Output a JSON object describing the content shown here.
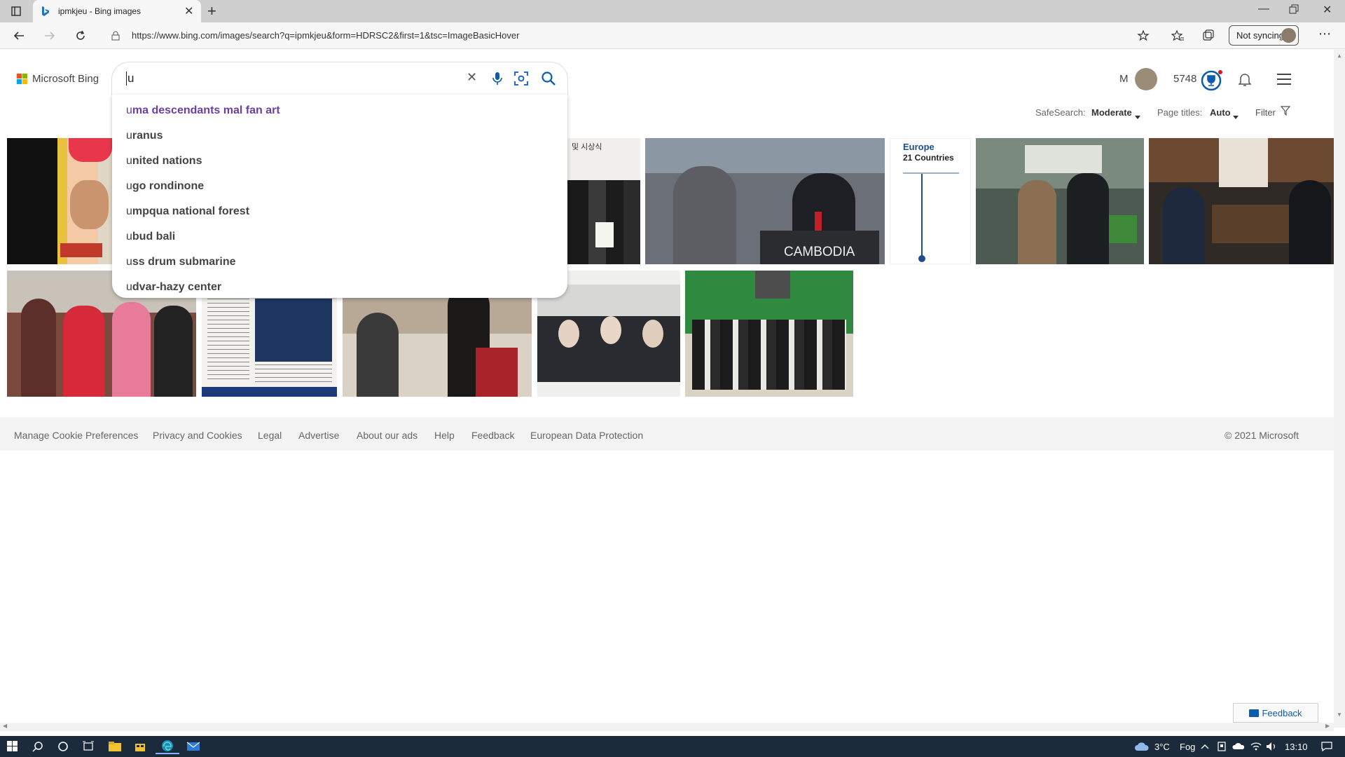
{
  "browser": {
    "tab_title": "ipmkjeu - Bing images",
    "url": "https://www.bing.com/images/search?q=ipmkjeu&form=HDRSC2&first=1&tsc=ImageBasicHover",
    "sync_label": "Not syncing"
  },
  "header": {
    "logo_text": "Microsoft Bing",
    "search_value": "u",
    "user_initial": "M",
    "points": "5748"
  },
  "suggestions": [
    {
      "prefix": "u",
      "rest": "ma descendants mal fan art"
    },
    {
      "prefix": "u",
      "rest": "ranus"
    },
    {
      "prefix": "u",
      "rest": "nited nations"
    },
    {
      "prefix": "u",
      "rest": "go rondinone"
    },
    {
      "prefix": "u",
      "rest": "mpqua national forest"
    },
    {
      "prefix": "u",
      "rest": "bud bali"
    },
    {
      "prefix": "u",
      "rest": "ss drum submarine"
    },
    {
      "prefix": "u",
      "rest": "dvar-hazy center"
    }
  ],
  "filters": {
    "safesearch_label": "SafeSearch:",
    "safesearch_value": "Moderate",
    "pagetitles_label": "Page titles:",
    "pagetitles_value": "Auto",
    "filter_label": "Filter"
  },
  "thumbs": {
    "europe_line1": "Europe",
    "europe_line2": "21 Countries",
    "cambodia_label": "CAMBODIA",
    "korean_caption": "및 시상식"
  },
  "footer": {
    "links": [
      "Manage Cookie Preferences",
      "Privacy and Cookies",
      "Legal",
      "Advertise",
      "About our ads",
      "Help",
      "Feedback",
      "European Data Protection"
    ],
    "copyright": "© 2021 Microsoft",
    "feedback_button": "Feedback"
  },
  "taskbar": {
    "temperature": "3°C",
    "weather": "Fog",
    "time": "13:10"
  },
  "colors": {
    "suggestion_first": "#6b3fa0",
    "bing_blue": "#0b5cad",
    "taskbar": "#1b2b3b"
  }
}
